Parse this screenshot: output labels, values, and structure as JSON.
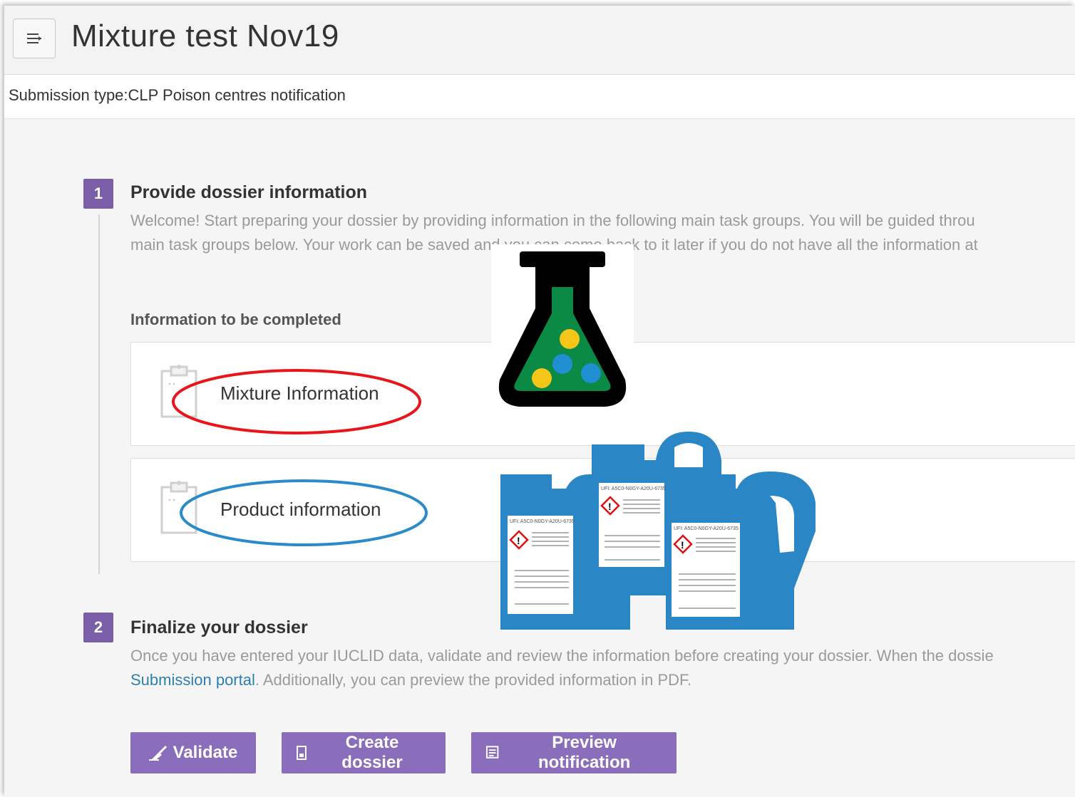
{
  "header": {
    "title": "Mixture test Nov19",
    "menu_icon": "menu-icon"
  },
  "submission": {
    "text": "Submission type:CLP Poison centres notification"
  },
  "steps": [
    {
      "number": "1",
      "title": "Provide dossier information",
      "desc_line1": "Welcome! Start preparing your dossier by providing information in the following main task groups. You will be guided throu",
      "desc_line2": "main task groups below. Your work can be saved and you can come back to it later if you do not have all the information at"
    },
    {
      "number": "2",
      "title": "Finalize your dossier",
      "desc_line1": "Once you have entered your IUCLID data, validate and review the information before creating your dossier. When the dossie",
      "desc_link": "Submission portal",
      "desc_line2_rest": ". Additionally, you can preview the provided information in PDF."
    }
  ],
  "info_heading": "Information to be completed",
  "cards": [
    {
      "label": "Mixture Information",
      "highlight_color": "#e8151b"
    },
    {
      "label": "Product information",
      "highlight_color": "#2a8bc8"
    }
  ],
  "buttons": {
    "validate": "Validate",
    "create": "Create dossier",
    "preview": "Preview notification"
  },
  "overlay": {
    "flask_icon": "flask-icon",
    "bottles_icon": "chemical-bottles-icon",
    "ufi_label": "UFI: A5C0-N0GY-A20U-6735"
  },
  "colors": {
    "step_badge": "#7b5ea8",
    "button": "#8a6dbb",
    "link": "#2e7faf",
    "flask_liquid": "#0a8a45",
    "bottle_blue": "#2b86c5"
  }
}
